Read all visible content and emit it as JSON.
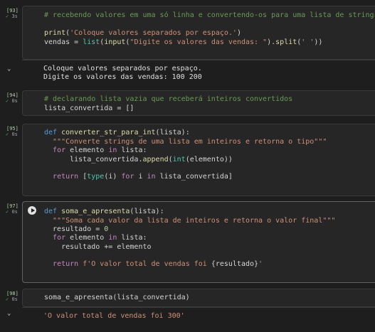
{
  "cells": [
    {
      "exec": "[93]",
      "time": "3s",
      "code": [
        "# recebendo valores em uma só linha e convertendo-os para uma lista de strings",
        "",
        "print('Coloque valores separados por espaço.')",
        "vendas = list(input(\"Digite os valores das vendas: \").split(' '))"
      ],
      "output": [
        "Coloque valores separados por espaço.",
        "Digite os valores das vendas: 100 200"
      ]
    },
    {
      "exec": "[94]",
      "time": "0s",
      "code": [
        "# declarando lista vazia que receberá inteiros convertidos",
        "lista_convertida = []"
      ]
    },
    {
      "exec": "[95]",
      "time": "0s",
      "code": [
        "def converter_str_para_int(lista):",
        "  \"\"\"Converte strings de uma lista em inteiros e retorna o tipo\"\"\"",
        "  for elemento in lista:",
        "      lista_convertida.append(int(elemento))",
        "",
        "  return [type(i) for i in lista_convertida]"
      ]
    },
    {
      "exec": "[97]",
      "time": "0s",
      "code": [
        "def soma_e_apresenta(lista):",
        "  \"\"\"Soma cada valor da lista de inteiros e retorna o valor final\"\"\"",
        "  resultado = 0",
        "  for elemento in lista:",
        "    resultado += elemento",
        "",
        "  return f'O valor total de vendas foi {resultado}'"
      ]
    },
    {
      "exec": "[98]",
      "time": "0s",
      "code": [
        "soma_e_apresenta(lista_convertida)"
      ],
      "output": [
        "'O valor total de vendas foi 300'"
      ]
    }
  ],
  "icons": {
    "check": "✓",
    "chevron": "⌄"
  },
  "colors": {
    "success": "#4caf50",
    "comment": "#6a9955",
    "keyword": "#569cd6",
    "string": "#ce9178"
  }
}
